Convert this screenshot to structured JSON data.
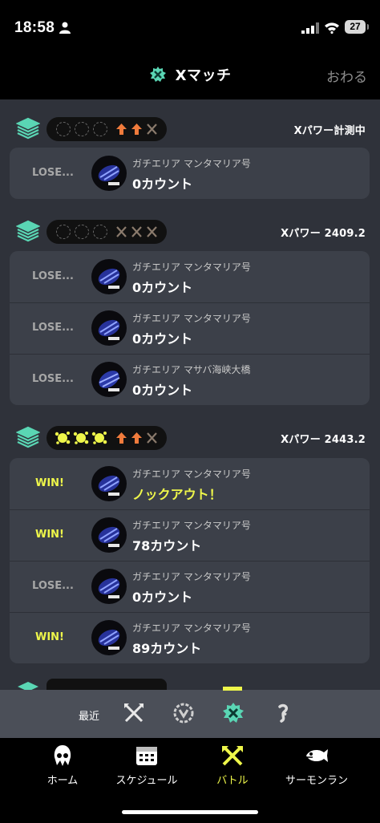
{
  "status_bar": {
    "time": "18:58",
    "battery": "27"
  },
  "header": {
    "title": "Xマッチ",
    "close_label": "おわる"
  },
  "groups": [
    {
      "xpower": "Xパワー計測中",
      "rounds": [
        {
          "stage": "ガチエリア マンタマリア号",
          "result": "LOSE...",
          "score": "0カウント"
        }
      ]
    },
    {
      "xpower": "Xパワー 2409.2",
      "rounds": [
        {
          "stage": "ガチエリア マンタマリア号",
          "result": "LOSE...",
          "score": "0カウント"
        },
        {
          "stage": "ガチエリア マンタマリア号",
          "result": "LOSE...",
          "score": "0カウント"
        },
        {
          "stage": "ガチエリア マサバ海峡大橋",
          "result": "LOSE...",
          "score": "0カウント"
        }
      ]
    },
    {
      "xpower": "Xパワー 2443.2",
      "rounds": [
        {
          "stage": "ガチエリア マンタマリア号",
          "result": "WIN!",
          "score": "ノックアウト！"
        },
        {
          "stage": "ガチエリア マンタマリア号",
          "result": "WIN!",
          "score": "78カウント"
        },
        {
          "stage": "ガチエリア マンタマリア号",
          "result": "LOSE...",
          "score": "0カウント"
        },
        {
          "stage": "ガチエリア マンタマリア号",
          "result": "WIN!",
          "score": "89カウント"
        }
      ]
    }
  ],
  "filter_bar": {
    "label": "最近",
    "icons": [
      "regular-battle-icon",
      "bankara-icon",
      "x-match-icon",
      "private-battle-icon"
    ],
    "selected": "x-match-icon"
  },
  "tabs": [
    {
      "label": "ホーム",
      "icon": "squid-icon"
    },
    {
      "label": "スケジュール",
      "icon": "calendar-icon"
    },
    {
      "label": "バトル",
      "icon": "battle-icon",
      "active": true
    },
    {
      "label": "サーモンラン",
      "icon": "salmon-icon"
    }
  ],
  "colors": {
    "accent": "#eef64a",
    "xmatch": "#5ad6b4",
    "background": "#2f323a",
    "card": "#3c4049",
    "lose_text": "#a7a7a7"
  }
}
